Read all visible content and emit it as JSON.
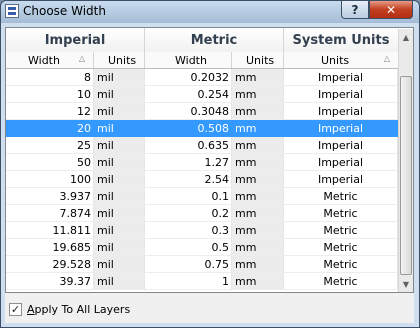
{
  "window": {
    "title": "Choose Width"
  },
  "titlebar": {
    "help_glyph": "?",
    "close_glyph": "✕"
  },
  "groups": {
    "imperial": "Imperial",
    "metric": "Metric",
    "system": "System Units"
  },
  "columns": {
    "imperial_width": "Width",
    "imperial_units": "Units",
    "metric_width": "Width",
    "metric_units": "Units",
    "system_units": "Units"
  },
  "rows": [
    {
      "imp": "8",
      "imp_u": "mil",
      "met": "0.2032",
      "met_u": "mm",
      "sys": "Imperial"
    },
    {
      "imp": "10",
      "imp_u": "mil",
      "met": "0.254",
      "met_u": "mm",
      "sys": "Imperial"
    },
    {
      "imp": "12",
      "imp_u": "mil",
      "met": "0.3048",
      "met_u": "mm",
      "sys": "Imperial"
    },
    {
      "imp": "20",
      "imp_u": "mil",
      "met": "0.508",
      "met_u": "mm",
      "sys": "Imperial"
    },
    {
      "imp": "25",
      "imp_u": "mil",
      "met": "0.635",
      "met_u": "mm",
      "sys": "Imperial"
    },
    {
      "imp": "50",
      "imp_u": "mil",
      "met": "1.27",
      "met_u": "mm",
      "sys": "Imperial"
    },
    {
      "imp": "100",
      "imp_u": "mil",
      "met": "2.54",
      "met_u": "mm",
      "sys": "Imperial"
    },
    {
      "imp": "3.937",
      "imp_u": "mil",
      "met": "0.1",
      "met_u": "mm",
      "sys": "Metric"
    },
    {
      "imp": "7.874",
      "imp_u": "mil",
      "met": "0.2",
      "met_u": "mm",
      "sys": "Metric"
    },
    {
      "imp": "11.811",
      "imp_u": "mil",
      "met": "0.3",
      "met_u": "mm",
      "sys": "Metric"
    },
    {
      "imp": "19.685",
      "imp_u": "mil",
      "met": "0.5",
      "met_u": "mm",
      "sys": "Metric"
    },
    {
      "imp": "29.528",
      "imp_u": "mil",
      "met": "0.75",
      "met_u": "mm",
      "sys": "Metric"
    },
    {
      "imp": "39.37",
      "imp_u": "mil",
      "met": "1",
      "met_u": "mm",
      "sys": "Metric"
    }
  ],
  "selected_row": 3,
  "footer": {
    "apply_label": "Apply To All Layers",
    "apply_checked": true,
    "check_glyph": "✓"
  },
  "colors": {
    "selection": "#3399ff",
    "shaded_column": "#ececec"
  }
}
